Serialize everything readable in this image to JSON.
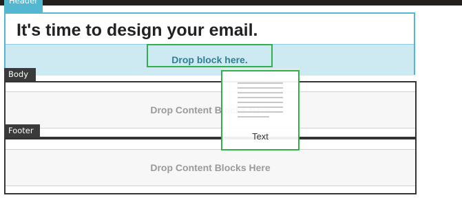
{
  "sections": {
    "header_tag": "Header",
    "body_tag": "Body",
    "footer_tag": "Footer"
  },
  "header": {
    "title": "It's time to design your email.",
    "drop_placeholder": "Drop block here."
  },
  "body": {
    "drop_text": "Drop Content Blocks Here"
  },
  "footer": {
    "drop_text": "Drop Content Blocks Here"
  },
  "dragging_block": {
    "label": "Text",
    "icon": "text-block-icon"
  },
  "colors": {
    "header_accent": "#54b7d1",
    "drop_highlight": "#cde9f2",
    "drag_outline": "#31b049",
    "section_tag": "#3a3a3a"
  }
}
